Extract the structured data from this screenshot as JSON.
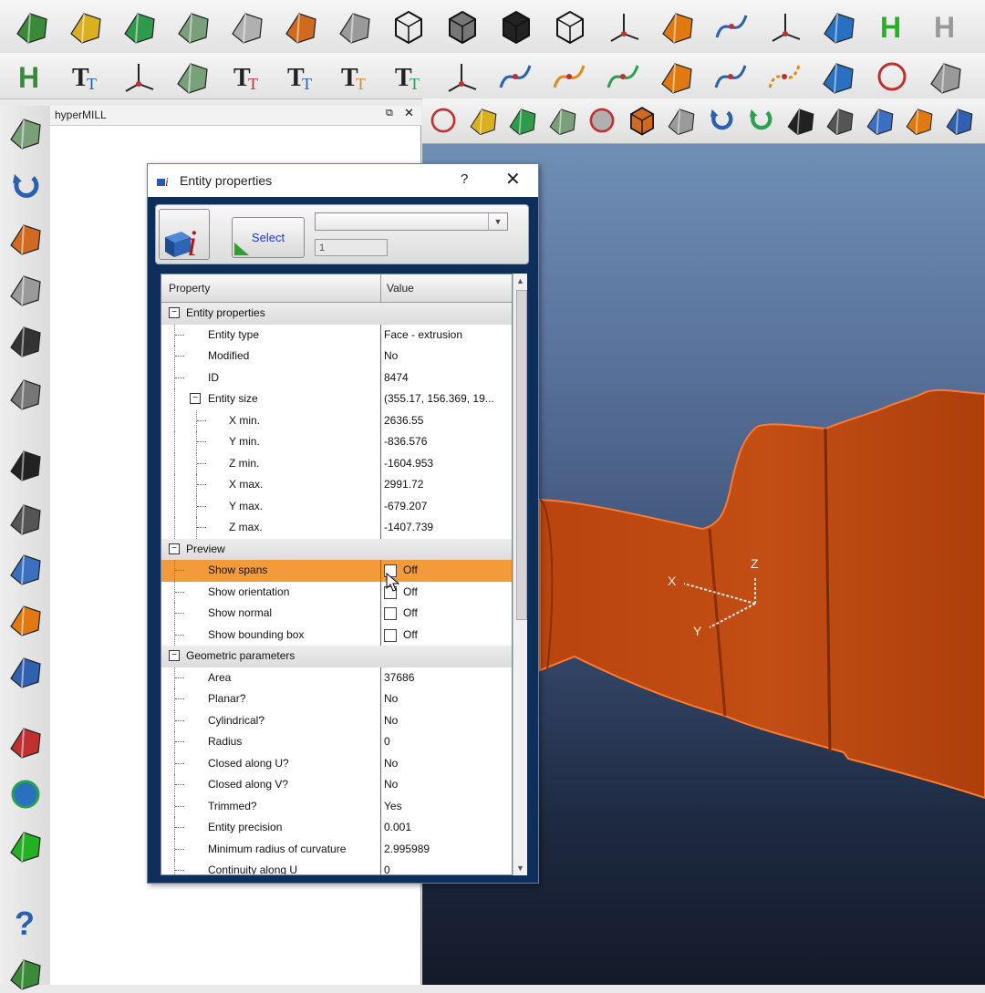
{
  "colors": {
    "dialog_frame": "#0e2f5c",
    "highlight": "#f39a3a",
    "part": "#c04a10",
    "part_edge": "#ff7a30",
    "viewport_top": "#6f8fb5",
    "viewport_bottom": "#141a29"
  },
  "toolbar_top": {
    "icons": [
      "pocket-icon",
      "boss-icon",
      "cylinder-stack-icon",
      "surface-icon",
      "aircraft-icon",
      "star-icon",
      "tool-holder-icon",
      "wireframe-box-icon",
      "solid-box-icon",
      "dark-box-icon",
      "polyhedron-icon",
      "axes-transform-icon",
      "orange-plane-icon",
      "curve-axes-icon",
      "point-axes-icon",
      "magnet-icon",
      "h-green-icon",
      "h-icon"
    ]
  },
  "toolbar_second": {
    "icons": [
      "wrench-icon",
      "text-panel-icon",
      "xyz-arrow-icon",
      "part-10-icon",
      "text-tt-icon",
      "text-slant-icon",
      "text-dot-icon",
      "text-pencil-icon",
      "xyz-point-icon",
      "arc-point-icon",
      "curve-point-icon",
      "spline-icon",
      "sphere-icon",
      "v-curve-icon",
      "dashed-line-icon",
      "rectangle-icon",
      "circle-r-icon",
      "corner-icon"
    ]
  },
  "toolbar_third": {
    "icons": [
      "power-icon",
      "import-icon",
      "export-icon",
      "merge-icon",
      "gear-icon",
      "info-cube-icon",
      "info-2i-icon",
      "undo-icon",
      "redo-icon",
      "arrow-left-icon",
      "r-check-icon",
      "lasso-icon",
      "layer-icon",
      "hat-icon"
    ]
  },
  "left_toolbar": {
    "icons": [
      "list-icon",
      "undo-arrow-icon",
      "delete-cross-icon",
      "blue-surface-icon",
      "pipe-icon",
      "hat-red-icon",
      "fill-surface-icon",
      "swept-icon",
      "layers-red-icon",
      "frame-icon",
      "rounded-rect-icon",
      "split-icon",
      "disk-icon",
      "cross-split-icon",
      "help-icon",
      "info-bar-icon"
    ]
  },
  "panel": {
    "title": "hyperMILL"
  },
  "dialog": {
    "title": "Entity properties",
    "help": "?",
    "close": "✕",
    "select_label": "Select",
    "combo_value": "",
    "count_value": "1",
    "header_property": "Property",
    "header_value": "Value",
    "rows": [
      {
        "kind": "cat",
        "name": "Entity properties",
        "level": 0,
        "value": ""
      },
      {
        "kind": "item",
        "name": "Entity type",
        "level": 1,
        "value": "Face - extrusion"
      },
      {
        "kind": "item",
        "name": "Modified",
        "level": 1,
        "value": "No"
      },
      {
        "kind": "item",
        "name": "ID",
        "level": 1,
        "value": "8474"
      },
      {
        "kind": "sub",
        "name": "Entity size",
        "level": 1,
        "value": "(355.17, 156.369, 19..."
      },
      {
        "kind": "item",
        "name": "X min.",
        "level": 2,
        "value": "2636.55"
      },
      {
        "kind": "item",
        "name": "Y min.",
        "level": 2,
        "value": "-836.576"
      },
      {
        "kind": "item",
        "name": "Z min.",
        "level": 2,
        "value": "-1604.953"
      },
      {
        "kind": "item",
        "name": "X max.",
        "level": 2,
        "value": "2991.72"
      },
      {
        "kind": "item",
        "name": "Y max.",
        "level": 2,
        "value": "-679.207"
      },
      {
        "kind": "item",
        "name": "Z max.",
        "level": 2,
        "value": "-1407.739"
      },
      {
        "kind": "cat",
        "name": "Preview",
        "level": 0,
        "value": ""
      },
      {
        "kind": "check",
        "name": "Show spans",
        "level": 1,
        "value": "Off",
        "highlight": true
      },
      {
        "kind": "check",
        "name": "Show orientation",
        "level": 1,
        "value": "Off"
      },
      {
        "kind": "check",
        "name": "Show normal",
        "level": 1,
        "value": "Off"
      },
      {
        "kind": "check",
        "name": "Show bounding box",
        "level": 1,
        "value": "Off"
      },
      {
        "kind": "cat",
        "name": "Geometric parameters",
        "level": 0,
        "value": ""
      },
      {
        "kind": "item",
        "name": "Area",
        "level": 1,
        "value": "37686"
      },
      {
        "kind": "item",
        "name": "Planar?",
        "level": 1,
        "value": "No"
      },
      {
        "kind": "item",
        "name": "Cylindrical?",
        "level": 1,
        "value": "No"
      },
      {
        "kind": "item",
        "name": "Radius",
        "level": 1,
        "value": "0"
      },
      {
        "kind": "item",
        "name": "Closed along U?",
        "level": 1,
        "value": "No"
      },
      {
        "kind": "item",
        "name": "Closed along V?",
        "level": 1,
        "value": "No"
      },
      {
        "kind": "item",
        "name": "Trimmed?",
        "level": 1,
        "value": "Yes"
      },
      {
        "kind": "item",
        "name": "Entity precision",
        "level": 1,
        "value": "0.001"
      },
      {
        "kind": "item",
        "name": "Minimum radius of curvature",
        "level": 1,
        "value": "2.995989"
      },
      {
        "kind": "item",
        "name": "Continuity along U",
        "level": 1,
        "value": "0"
      }
    ]
  },
  "viewport": {
    "axis_x": "X",
    "axis_y": "Y",
    "axis_z": "Z"
  }
}
